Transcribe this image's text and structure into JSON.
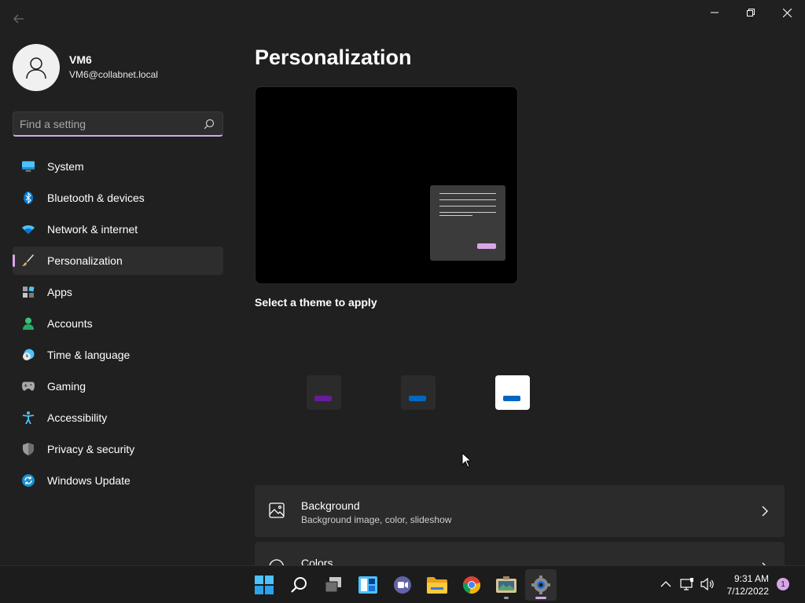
{
  "window": {
    "back_icon": "back-arrow-icon",
    "controls": [
      "minimize-icon",
      "maximize-icon",
      "close-icon"
    ]
  },
  "profile": {
    "name": "VM6",
    "email": "VM6@collabnet.local",
    "avatar_icon": "user-avatar-icon"
  },
  "search": {
    "placeholder": "Find a setting",
    "value": "",
    "icon": "search-icon"
  },
  "nav": {
    "items": [
      {
        "label": "System",
        "icon": "monitor-icon",
        "active": false
      },
      {
        "label": "Bluetooth & devices",
        "icon": "bluetooth-icon",
        "active": false
      },
      {
        "label": "Network & internet",
        "icon": "wifi-icon",
        "active": false
      },
      {
        "label": "Personalization",
        "icon": "paintbrush-icon",
        "active": true
      },
      {
        "label": "Apps",
        "icon": "apps-icon",
        "active": false
      },
      {
        "label": "Accounts",
        "icon": "person-icon",
        "active": false
      },
      {
        "label": "Time & language",
        "icon": "clock-globe-icon",
        "active": false
      },
      {
        "label": "Gaming",
        "icon": "gamepad-icon",
        "active": false
      },
      {
        "label": "Accessibility",
        "icon": "accessibility-icon",
        "active": false
      },
      {
        "label": "Privacy & security",
        "icon": "shield-icon",
        "active": false
      },
      {
        "label": "Windows Update",
        "icon": "update-icon",
        "active": false
      }
    ]
  },
  "main": {
    "title": "Personalization",
    "theme_section_title": "Select a theme to apply",
    "themes": [
      {
        "name": "theme-dark-purple",
        "tile_color": "#2b2b2b",
        "accent": "#6a1b9a"
      },
      {
        "name": "theme-dark-blue",
        "tile_color": "#2b2b2b",
        "accent": "#0067c0"
      },
      {
        "name": "theme-light",
        "tile_color": "#ffffff",
        "accent": "#0067c0"
      }
    ],
    "cards": [
      {
        "title": "Background",
        "subtitle": "Background image, color, slideshow",
        "icon": "image-icon"
      },
      {
        "title": "Colors",
        "subtitle": "",
        "icon": "palette-icon"
      }
    ]
  },
  "taskbar": {
    "apps": [
      {
        "name": "start-button",
        "icon": "windows-logo-icon",
        "active": false
      },
      {
        "name": "search-button",
        "icon": "search-icon",
        "active": false
      },
      {
        "name": "task-view-button",
        "icon": "task-view-icon",
        "active": false
      },
      {
        "name": "widgets-button",
        "icon": "widgets-icon",
        "active": false
      },
      {
        "name": "teams-chat-button",
        "icon": "teams-chat-icon",
        "active": false
      },
      {
        "name": "file-explorer-button",
        "icon": "folder-icon",
        "active": false
      },
      {
        "name": "chrome-button",
        "icon": "chrome-icon",
        "active": false
      },
      {
        "name": "app-button",
        "icon": "app-icon",
        "active": false
      },
      {
        "name": "settings-button",
        "icon": "settings-gear-icon",
        "active": true
      }
    ],
    "tray": {
      "chevron_icon": "chevron-up-icon",
      "network_icon": "network-icon",
      "volume_icon": "volume-icon",
      "time": "9:31 AM",
      "date": "7/12/2022",
      "notification_count": "1"
    }
  },
  "colors": {
    "accent": "#d8a6e8",
    "background": "#202020",
    "card": "#2b2b2b"
  }
}
